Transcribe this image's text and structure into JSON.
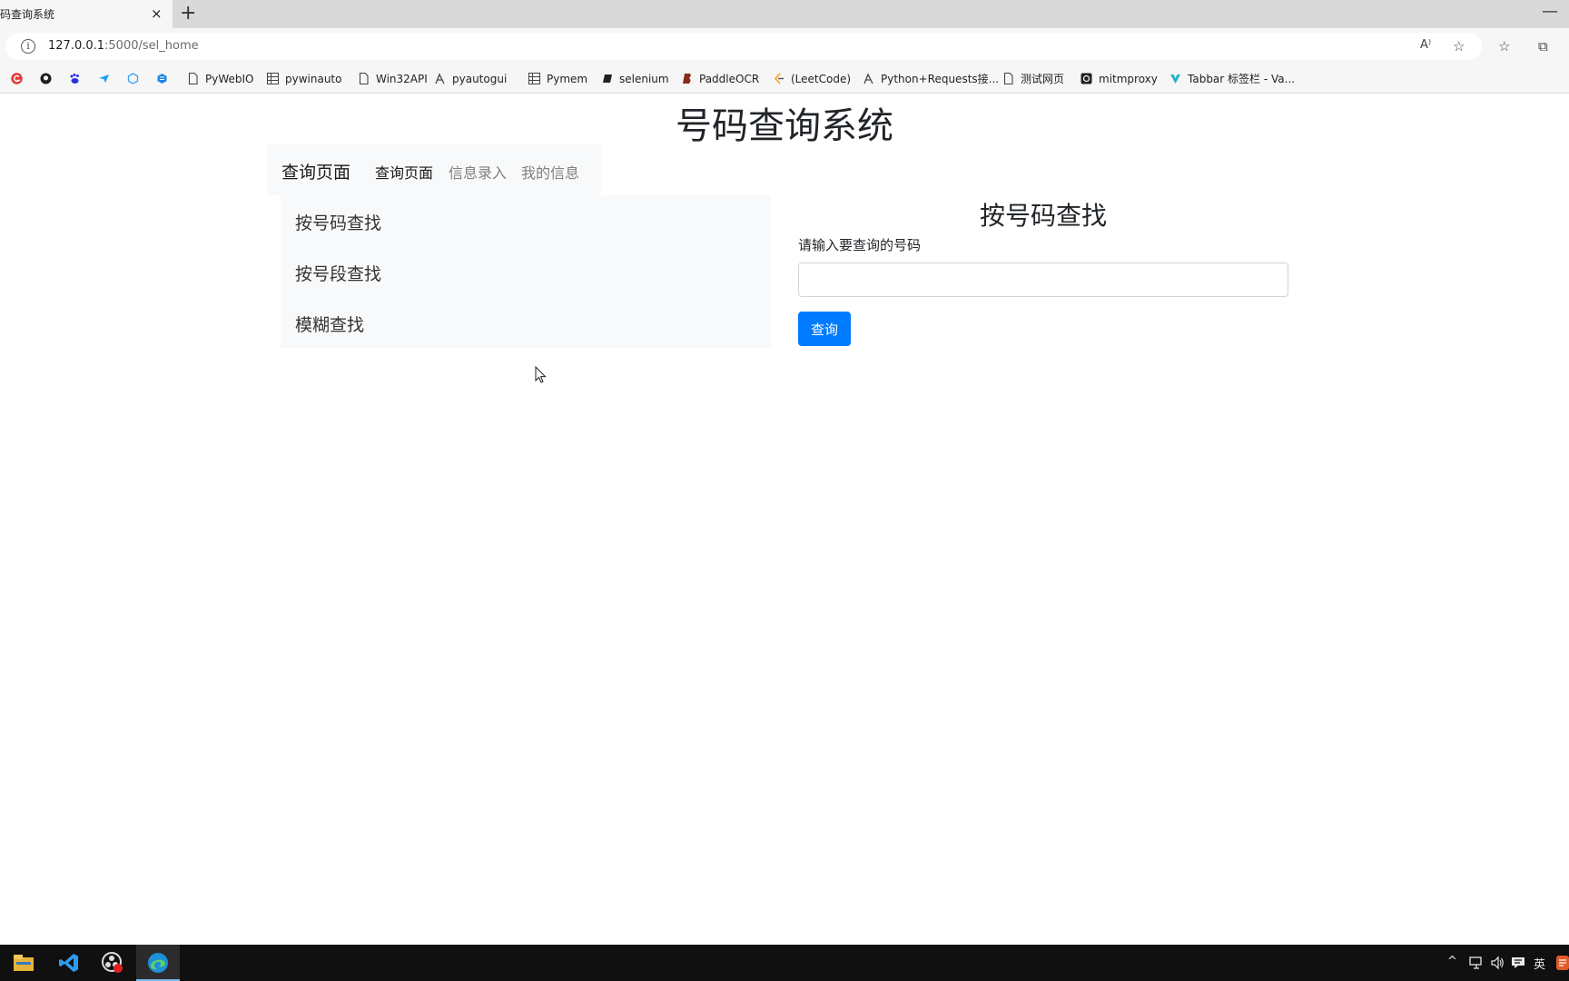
{
  "browser": {
    "tab_title": "码查询系统",
    "tab_close": "×",
    "new_tab": "+",
    "minimize": "—",
    "url_host": "127.0.0.1",
    "url_path": ":5000/sel_home",
    "info_glyph": "i",
    "read_aloud": "A⁾",
    "favorite_add": "☆",
    "favorites": "☆",
    "collections": "⧉"
  },
  "bookmarks": [
    {
      "label": "",
      "icon": "red-g-icon",
      "color": "#e53935"
    },
    {
      "label": "",
      "icon": "github-icon",
      "color": "#1f1f1f"
    },
    {
      "label": "",
      "icon": "baidu-icon",
      "color": "#2932e1"
    },
    {
      "label": "",
      "icon": "bird-icon",
      "color": "#1da1f2"
    },
    {
      "label": "",
      "icon": "cube-icon",
      "color": "#3aa0f3"
    },
    {
      "label": "",
      "icon": "blue-cube-icon",
      "color": "#1e88e5"
    },
    {
      "label": "PyWebIO",
      "icon": "page-icon",
      "color": "#444444"
    },
    {
      "label": "pywinauto",
      "icon": "grid-icon",
      "color": "#444444"
    },
    {
      "label": "Win32API",
      "icon": "page-icon",
      "color": "#444444"
    },
    {
      "label": "pyautogui",
      "icon": "snake-icon",
      "color": "#444444"
    },
    {
      "label": "Pymem",
      "icon": "grid-icon",
      "color": "#444444"
    },
    {
      "label": "selenium",
      "icon": "book-icon",
      "color": "#222222"
    },
    {
      "label": "PaddleOCR",
      "icon": "paddle-icon",
      "color": "#8a2a1a"
    },
    {
      "label": "(LeetCode)",
      "icon": "leetcode-icon",
      "color": "#f89f1b"
    },
    {
      "label": "Python+Requests接...",
      "icon": "snake-icon",
      "color": "#444444"
    },
    {
      "label": "测试网页",
      "icon": "page-icon",
      "color": "#444444"
    },
    {
      "label": "mitmproxy",
      "icon": "mitm-icon",
      "color": "#222222"
    },
    {
      "label": "Tabbar 标签栏 - Va...",
      "icon": "vant-icon",
      "color": "#1fb6c9"
    }
  ],
  "page": {
    "title": "号码查询系统",
    "navbar": {
      "brand": "查询页面",
      "links": [
        {
          "label": "查询页面",
          "active": true
        },
        {
          "label": "信息录入",
          "active": false
        },
        {
          "label": "我的信息",
          "active": false
        }
      ]
    },
    "sidebar": {
      "items": [
        "按号码查找",
        "按号段查找",
        "模糊查找"
      ]
    },
    "form": {
      "title": "按号码查找",
      "label": "请输入要查询的号码",
      "input_value": "",
      "button": "查询"
    }
  },
  "taskbar": {
    "apps": [
      "file-explorer-icon",
      "vscode-icon",
      "obs-icon",
      "edge-icon"
    ],
    "active_app": "edge-icon",
    "tray": {
      "chevron": "^",
      "ime": "英"
    }
  },
  "colors": {
    "primary": "#007bff",
    "navbar_bg": "#f8f9fa",
    "taskbar_bg": "#101010"
  }
}
